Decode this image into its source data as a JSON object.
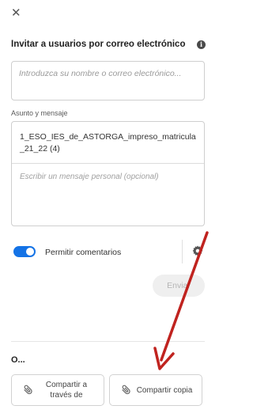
{
  "header": {
    "close_icon": "close-icon",
    "title": "Invitar a usuarios por correo electrónico",
    "info_icon_glyph": "i"
  },
  "email": {
    "placeholder": "Introduzca su nombre o correo electrónico..."
  },
  "message": {
    "label": "Asunto y mensaje",
    "subject": "1_ESO_IES_de_ASTORGA_impreso_matricula_21_22 (4)",
    "placeholder": "Escribir un mensaje personal (opcional)"
  },
  "options": {
    "allow_comments_label": "Permitir comentarios",
    "allow_comments_on": true,
    "settings_icon": "gear-icon"
  },
  "actions": {
    "send_label": "Enviar"
  },
  "alternatives": {
    "or_label": "O...",
    "share_via_label": "Compartir a través de",
    "share_copy_label": "Compartir copia",
    "share_icon": "paperclip-icon"
  },
  "annotation": {
    "arrow_color": "#c0231f"
  },
  "colors": {
    "accent": "#1473e6"
  }
}
